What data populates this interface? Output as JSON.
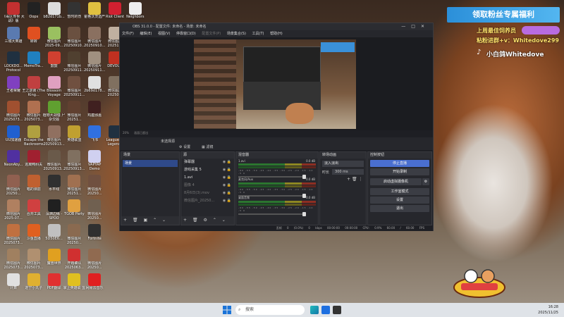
{
  "desktop": {
    "icons": [
      {
        "label": "《毒区传世\n大战》版",
        "color": "#c23030",
        "col": 0,
        "row": 0
      },
      {
        "label": "Oops",
        "color": "#222",
        "col": 1,
        "row": 0
      },
      {
        "label": "b82d171b...",
        "color": "#ddd",
        "col": 2,
        "row": 0
      },
      {
        "label": "暂时的伤",
        "color": "#333",
        "col": 3,
        "row": 0
      },
      {
        "label": "霍格沃茨遗产",
        "color": "#e0c040",
        "col": 4,
        "row": 0
      },
      {
        "label": "Riot Client",
        "color": "#d02030",
        "col": 5,
        "row": 0
      },
      {
        "label": "Neighbors",
        "color": "#eee",
        "col": 6,
        "row": 0
      },
      {
        "label": "三城大英雄",
        "color": "#5a7ab0",
        "col": 0,
        "row": 1
      },
      {
        "label": "转转",
        "color": "#e05020",
        "col": 1,
        "row": 1
      },
      {
        "label": "微信图片\n2025-09...",
        "color": "#9ac060",
        "col": 2,
        "row": 1
      },
      {
        "label": "微信图片\n20250910...",
        "color": "#6a5040",
        "col": 3,
        "row": 1
      },
      {
        "label": "微信图片\n20250910...",
        "color": "#8a7060",
        "col": 4,
        "row": 1
      },
      {
        "label": "微信图片\n20251...",
        "color": "#c0b0a0",
        "col": 5,
        "row": 1
      },
      {
        "label": "LOCKDO...\nProtocol",
        "color": "#203040",
        "col": 0,
        "row": 2
      },
      {
        "label": "MemoTra...",
        "color": "#2080c0",
        "col": 1,
        "row": 2
      },
      {
        "label": "鼓鼓",
        "color": "#d04030",
        "col": 2,
        "row": 2
      },
      {
        "label": "微信图片\n20250911...",
        "color": "#504030",
        "col": 3,
        "row": 2
      },
      {
        "label": "微信图片\n20250911...",
        "color": "#a09080",
        "col": 4,
        "row": 2
      },
      {
        "label": "DEVOUR",
        "color": "#c03020",
        "col": 5,
        "row": 2
      },
      {
        "label": "王者荣耀",
        "color": "#8040c0",
        "col": 0,
        "row": 3
      },
      {
        "label": "王之逆袭\n(The King...",
        "color": "#c04040",
        "col": 1,
        "row": 3
      },
      {
        "label": "Blossom\nVoyage",
        "color": "#e0a0c0",
        "col": 2,
        "row": 3
      },
      {
        "label": "微信图片\n20250911...",
        "color": "#705040",
        "col": 3,
        "row": 3
      },
      {
        "label": "2b69d178...",
        "color": "#e0e0e0",
        "col": 4,
        "row": 3
      },
      {
        "label": "微信图片\n20250...",
        "color": "#807060",
        "col": 5,
        "row": 3
      },
      {
        "label": "微信图片\n2025073...",
        "color": "#a05030",
        "col": 0,
        "row": 4
      },
      {
        "label": "微信图片\n2025073...",
        "color": "#b07050",
        "col": 1,
        "row": 4
      },
      {
        "label": "植物大战僵\n尸杂交版",
        "color": "#60a030",
        "col": 2,
        "row": 4
      },
      {
        "label": "微信图片\n20251...",
        "color": "#604030",
        "col": 3,
        "row": 4
      },
      {
        "label": "鸡瘟邪嘉",
        "color": "#402020",
        "col": 4,
        "row": 4
      },
      {
        "label": "UU加速器",
        "color": "#2060d0",
        "col": 0,
        "row": 5
      },
      {
        "label": "Escape the\nBackrooms",
        "color": "#b0a040",
        "col": 1,
        "row": 5
      },
      {
        "label": "微信图片\n20250913...",
        "color": "#907060",
        "col": 2,
        "row": 5
      },
      {
        "label": "英雄联盟",
        "color": "#c0a030",
        "col": 3,
        "row": 5
      },
      {
        "label": "飞书",
        "color": "#3070e0",
        "col": 4,
        "row": 5
      },
      {
        "label": "League of\nLegends",
        "color": "#203040",
        "col": 5,
        "row": 5
      },
      {
        "label": "NeonAby...",
        "color": "#5030a0",
        "col": 0,
        "row": 6
      },
      {
        "label": "逃离鸭科夫",
        "color": "#a02030",
        "col": 1,
        "row": 6
      },
      {
        "label": "微信图片\n20250913...",
        "color": "#6a5a4a",
        "col": 2,
        "row": 6
      },
      {
        "label": "微信图片\n20250913...",
        "color": "#807060",
        "col": 3,
        "row": 6
      },
      {
        "label": "VAPYAP\nDemo",
        "color": "#d0d0f0",
        "col": 4,
        "row": 6
      },
      {
        "label": "微信图片\n20250...",
        "color": "#906050",
        "col": 0,
        "row": 7
      },
      {
        "label": "喵的课前",
        "color": "#c06030",
        "col": 1,
        "row": 7
      },
      {
        "label": "水平线",
        "color": "#303030",
        "col": 2,
        "row": 7
      },
      {
        "label": "微信图片\n20251...",
        "color": "#a07050",
        "col": 3,
        "row": 7
      },
      {
        "label": "微信图片\n20250...",
        "color": "#705040",
        "col": 4,
        "row": 7
      },
      {
        "label": "微信图片\n2025-07...",
        "color": "#b08060",
        "col": 0,
        "row": 8
      },
      {
        "label": "合并工具",
        "color": "#d04040",
        "col": 1,
        "row": 8
      },
      {
        "label": "深渊边缘\n-SPOO",
        "color": "#202020",
        "col": 2,
        "row": 8
      },
      {
        "label": "TGOB\nParty",
        "color": "#e0a040",
        "col": 3,
        "row": 8
      },
      {
        "label": "微信图片\n20250...",
        "color": "#706050",
        "col": 4,
        "row": 8
      },
      {
        "label": "微信图片\n2025073...",
        "color": "#c07040",
        "col": 0,
        "row": 9
      },
      {
        "label": "斗鱼直播",
        "color": "#e06020",
        "col": 1,
        "row": 9
      },
      {
        "label": "5D50E6...",
        "color": "#c0c0c0",
        "col": 2,
        "row": 9
      },
      {
        "label": "微信图片\n20250...",
        "color": "#8a6a50",
        "col": 3,
        "row": 9
      },
      {
        "label": "Fortnite",
        "color": "#303030",
        "col": 4,
        "row": 9
      },
      {
        "label": "微信图片\n2025073...",
        "color": "#a08060",
        "col": 0,
        "row": 10
      },
      {
        "label": "微信图片\n2025073...",
        "color": "#b09070",
        "col": 1,
        "row": 10
      },
      {
        "label": "魔兽世界",
        "color": "#e0a020",
        "col": 2,
        "row": 10
      },
      {
        "label": "开题确认\n2025063...",
        "color": "#d03030",
        "col": 3,
        "row": 10
      },
      {
        "label": "微信图片\n20250...",
        "color": "#906a50",
        "col": 4,
        "row": 10
      },
      {
        "label": "计算",
        "color": "#e0e0e0",
        "col": 0,
        "row": 11
      },
      {
        "label": "遂宁小丸子",
        "color": "#e0b030",
        "col": 1,
        "row": 11
      },
      {
        "label": "PDF翻译",
        "color": "#e03030",
        "col": 2,
        "row": 11
      },
      {
        "label": "掌上英雄联\n盟",
        "color": "#e0c020",
        "col": 3,
        "row": 11
      },
      {
        "label": "网易云音乐",
        "color": "#e02020",
        "col": 4,
        "row": 11
      }
    ]
  },
  "overlay": {
    "promo": "领取粉丝专属福利",
    "line1": "上周最佳饲养员",
    "line2": "粘粉进群+v：Whitedove299",
    "line3": "小白鸽Whitedove"
  },
  "obs": {
    "title": "OBS 31.0.0 - 配置文件: 未命名 - 场景: 未命名",
    "menu": [
      "文件(F)",
      "编辑(E)",
      "视图(V)",
      "停靠窗口(D)",
      "配置文件(P)",
      "场景集合(S)",
      "工具(T)",
      "帮助(H)"
    ],
    "preview_zoom": "20%",
    "preview_status": "画面已超出",
    "source_label": "未选择源",
    "settings_button": "设置",
    "filters_button": "滤镜",
    "panels": {
      "scenes": {
        "title": "场景",
        "items": [
          "场景"
        ]
      },
      "sources": {
        "title": "源",
        "items": [
          {
            "label": "弹幕器",
            "dim": false
          },
          {
            "label": "游戏采集 5",
            "dim": false
          },
          {
            "label": "1.avi",
            "dim": false
          },
          {
            "label": "图像 4",
            "dim": true
          },
          {
            "label": "8月6日(3).mov",
            "dim": true
          },
          {
            "label": "微信图片_20250...",
            "dim": true
          }
        ]
      },
      "mixer": {
        "title": "混音器",
        "channels": [
          {
            "name": "1.avi",
            "db": "0.0 dB"
          },
          {
            "name": "麦克风/Aux",
            "db": "0.0 dB"
          },
          {
            "name": "桌面音频",
            "db": "0.0 dB"
          }
        ],
        "scale": "-60 -55 -50 -45 -40 -35 -30 -25 -20 -15 -10 -5 0"
      },
      "transitions": {
        "title": "转场动画",
        "type": "淡入淡出",
        "duration_label": "时长",
        "duration": "300 ms"
      },
      "controls": {
        "title": "控制按钮",
        "buttons": [
          "停止直播",
          "开始录制",
          "启动虚拟摄像机",
          "工作室模式",
          "设置",
          "退出"
        ]
      }
    },
    "status": {
      "frames": "丢帧 0 (0.0%)",
      "bitrate": "0 kbps",
      "stream_time": "00:00:00",
      "rec_time": "00:00:00",
      "cpu": "CPU: 0.9%",
      "fps": "60.00 / 60.00 FPS"
    }
  },
  "taskbar": {
    "search_placeholder": "搜索",
    "time": "16:28",
    "date": "2025/11/25"
  }
}
